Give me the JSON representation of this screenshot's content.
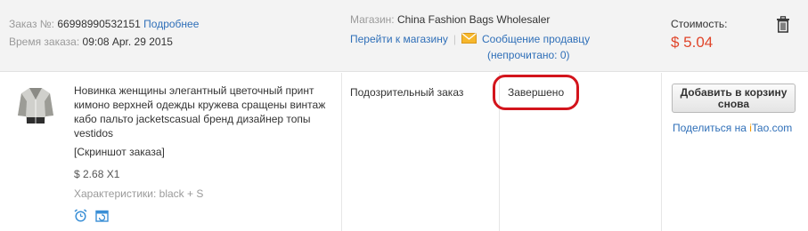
{
  "order": {
    "number_label": "Заказ №:",
    "number": "66998990532151",
    "details_link": "Подробнее",
    "time_label": "Время заказа:",
    "time": "09:08 Apr. 29 2015"
  },
  "store": {
    "label": "Магазин:",
    "name": "China Fashion Bags Wholesaler",
    "go_to_store": "Перейти к магазину",
    "separator": "|",
    "message_seller": "Сообщение продавцу",
    "unread": "(непрочитано: 0)"
  },
  "cost": {
    "label": "Стоимость:",
    "value": "$ 5.04"
  },
  "item": {
    "title": "Новинка женщины элегантный цветочный принт кимоно верхней одежды кружева сращены винтаж кабо пальто jacketscasual бренд дизайнер топы vestidos",
    "snapshot": "[Скриншот заказа]",
    "unit_price": "$ 2.68 X1",
    "attributes": "Характеристики: black + S"
  },
  "status": {
    "suspicious": "Подозрительный заказ",
    "completed": "Завершено"
  },
  "actions": {
    "add_to_cart": "Добавить в корзину снова",
    "share_prefix": "Поделиться на ",
    "share_i": "i",
    "share_tao": "Tao",
    "share_suffix": ".com"
  },
  "colors": {
    "header_bg": "#f3f3f3",
    "link": "#2f6fb8",
    "price": "#e0452a",
    "highlight_circle": "#d3141c",
    "itao_orange": "#f39800"
  },
  "icons": [
    "trash-icon",
    "mail-icon",
    "product-thumbnail",
    "alarm-clock-icon",
    "refresh-calendar-icon"
  ]
}
